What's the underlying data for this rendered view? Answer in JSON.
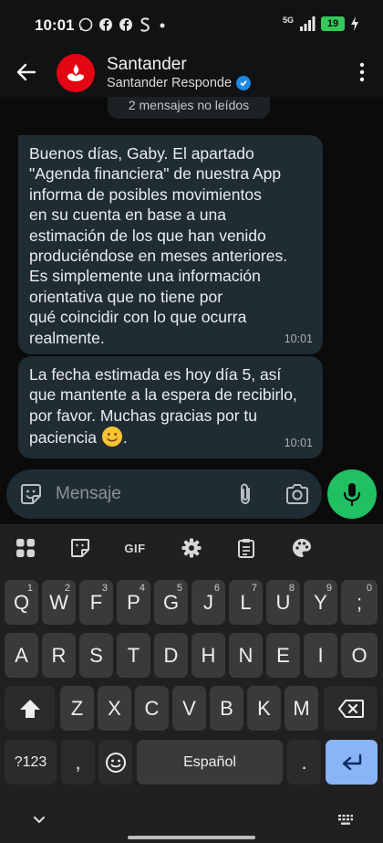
{
  "status_bar": {
    "time": "10:01",
    "notification_icons": [
      "whatsapp-icon",
      "facebook-icon",
      "facebook-icon",
      "s-icon",
      "dot"
    ],
    "network": "5G",
    "battery": "19"
  },
  "header": {
    "title": "Santander",
    "subtitle": "Santander Responde",
    "brand_color": "#e30613"
  },
  "chat": {
    "unread_banner": "2 mensajes no leídos",
    "messages": [
      {
        "lines": [
          "Buenos días, Gaby. El apartado",
          "\"Agenda financiera\" de nuestra App",
          "informa de posibles movimientos",
          "en su cuenta en base a una",
          "estimación de los que han venido",
          "produciéndose en meses anteriores.",
          "Es simplemente una información",
          "orientativa que no tiene por",
          "qué coincidir con lo que ocurra",
          "realmente."
        ],
        "time": "10:01"
      },
      {
        "lines": [
          "La fecha estimada es hoy día 5, así",
          "que mantente a la espera de recibirlo,",
          "por favor. Muchas gracias por tu",
          "paciencia"
        ],
        "trailing": ".",
        "time": "10:01"
      }
    ]
  },
  "composer": {
    "placeholder": "Mensaje",
    "accent": "#21c063"
  },
  "keyboard": {
    "toolbar": [
      "apps-icon",
      "sticker-icon",
      "GIF",
      "settings-icon",
      "clipboard-icon",
      "palette-icon"
    ],
    "row1": [
      {
        "k": "Q",
        "s": "1"
      },
      {
        "k": "W",
        "s": "2"
      },
      {
        "k": "F",
        "s": "3"
      },
      {
        "k": "P",
        "s": "4"
      },
      {
        "k": "G",
        "s": "5"
      },
      {
        "k": "J",
        "s": "6"
      },
      {
        "k": "L",
        "s": "7"
      },
      {
        "k": "U",
        "s": "8"
      },
      {
        "k": "Y",
        "s": "9"
      },
      {
        "k": ";",
        "s": "0"
      }
    ],
    "row2": [
      "A",
      "R",
      "S",
      "T",
      "D",
      "H",
      "N",
      "E",
      "I",
      "O"
    ],
    "row3": [
      "Z",
      "X",
      "C",
      "V",
      "B",
      "K",
      "M"
    ],
    "row4": {
      "symbols": "?123",
      "comma": ",",
      "space": "Español",
      "period": "."
    }
  }
}
